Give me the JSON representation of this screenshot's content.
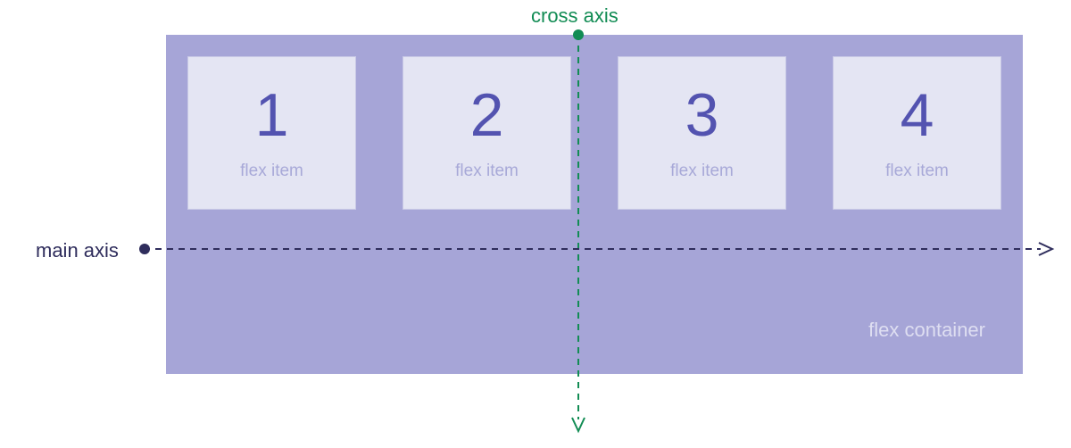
{
  "diagram": {
    "main_axis_label": "main axis",
    "cross_axis_label": "cross axis",
    "container_label": "flex container",
    "item_label": "flex item",
    "items": [
      {
        "number": "1"
      },
      {
        "number": "2"
      },
      {
        "number": "3"
      },
      {
        "number": "4"
      }
    ],
    "colors": {
      "container_bg": "#a6a5d7",
      "item_bg": "#e4e5f3",
      "item_number": "#5353b0",
      "main_axis": "#2f2d5c",
      "cross_axis": "#128c54"
    }
  }
}
